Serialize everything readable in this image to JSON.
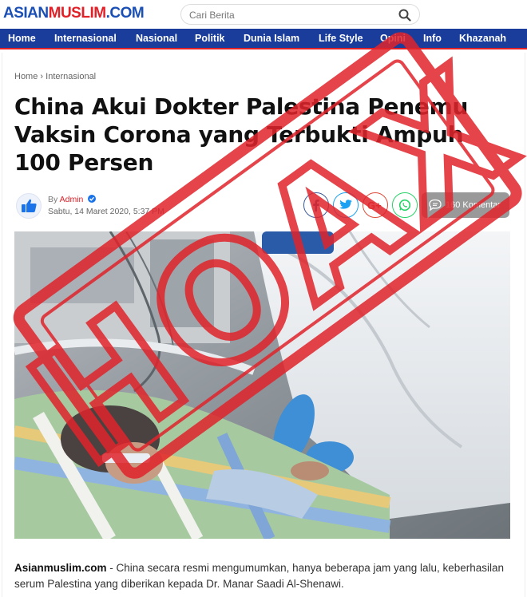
{
  "site": {
    "logo_part1": "ASIAN",
    "logo_part2": "MUSLIM",
    "logo_part3": ".COM"
  },
  "search": {
    "placeholder": "Cari Berita",
    "icon": "search-icon"
  },
  "nav": [
    "Home",
    "Internasional",
    "Nasional",
    "Politik",
    "Dunia Islam",
    "Life Style",
    "Opini",
    "Info",
    "Khazanah"
  ],
  "breadcrumb": {
    "home": "Home",
    "sep": "›",
    "section": "Internasional"
  },
  "article": {
    "title": "China Akui Dokter Palestina Penemu Vaksin Corona yang Terbukti Ampuh 100 Persen",
    "by_label": "By",
    "author": "Admin",
    "date": "Sabtu, 14 Maret 2020,  5:37 PM",
    "comments": "160 Komentar",
    "lead_source": "Asianmuslim.com",
    "lead_text": " - China secara resmi mengumumkan, hanya beberapa jam yang lalu, keberhasilan serum Palestina yang diberikan kepada Dr. Manar Saadi Al-Shenawi."
  },
  "share_icons": [
    "facebook-icon",
    "twitter-icon",
    "google-plus-icon",
    "whatsapp-icon"
  ],
  "stamp": {
    "text": "HOAX",
    "color": "#e0242b"
  },
  "colors": {
    "brand_blue": "#1a3d9c",
    "brand_red": "#e12128"
  }
}
